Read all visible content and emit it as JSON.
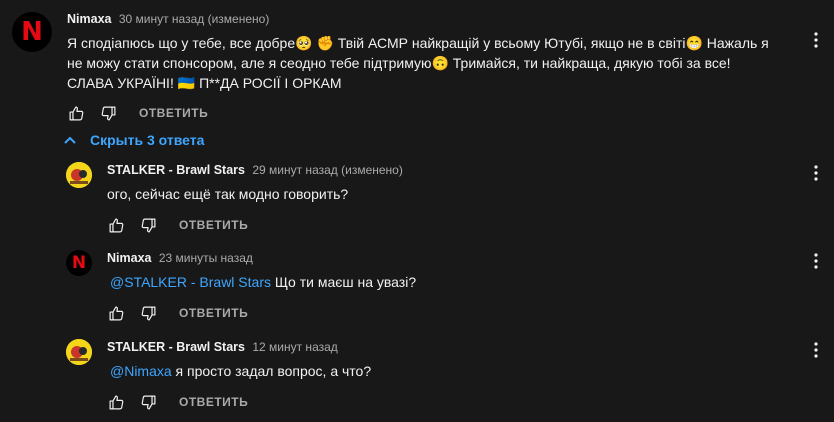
{
  "comment": {
    "author": "Nimaxa",
    "time": "30 минут назад (изменено)",
    "text_part1": "Я сподіапюсь що у тебе, все добре🥺 ✊ Твій АСМР найкращій у всьому Ютубі, якщо не в світі😁 Нажаль я не можу стати спонсором, але я сеодно тебе підтримую🙃 Тримайся, ти найкраща, дякую тобі за все! СЛАВА УКРАЇНІ! ",
    "flags": "🇺🇦",
    "text_part2": "П**ДА РОСІЇ І ОРКАМ",
    "reply_label": "ОТВЕТИТЬ"
  },
  "replies_toggle": {
    "label": "Скрыть 3 ответа",
    "accent": "#3ea6ff"
  },
  "replies": [
    {
      "author": "STALKER - Brawl Stars",
      "time": "29 минут назад (изменено)",
      "mention": "",
      "text": "ого, сейчас ещё так модно говорить?",
      "reply_label": "ОТВЕТИТЬ"
    },
    {
      "author": "Nimaxa",
      "time": "23 минуты назад",
      "mention": "@STALKER - Brawl Stars",
      "text": " Що ти маєш на увазі?",
      "reply_label": "ОТВЕТИТЬ"
    },
    {
      "author": "STALKER - Brawl Stars",
      "time": "12 минут назад",
      "mention": "@Nimaxa",
      "text": " я просто задал вопрос, а что?",
      "reply_label": "ОТВЕТИТЬ"
    }
  ],
  "icons": {
    "like": "thumbs-up-icon",
    "dislike": "thumbs-down-icon",
    "menu": "more-vertical-icon",
    "chevron": "chevron-up-icon",
    "avatar_nimaxa": "netflix-logo-avatar",
    "avatar_stalker": "stalker-avatar"
  },
  "colors": {
    "background": "#181818",
    "text": "#f1f1f1",
    "secondary": "#aaaaaa",
    "link": "#3ea6ff"
  }
}
